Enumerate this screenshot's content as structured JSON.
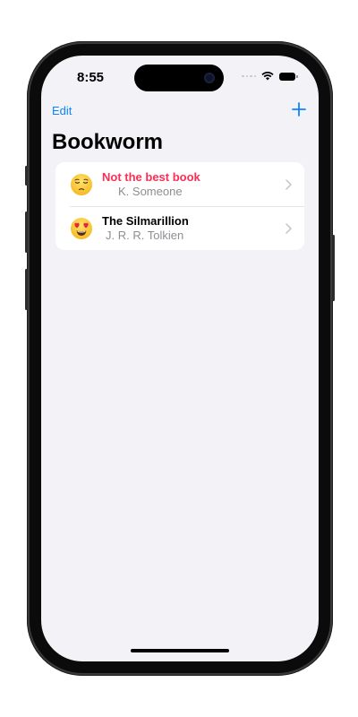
{
  "status_bar": {
    "time": "8:55"
  },
  "nav": {
    "edit_label": "Edit",
    "add_icon": "plus-icon",
    "title": "Bookworm"
  },
  "books": [
    {
      "title": "Not the best book",
      "author": "K. Someone",
      "rating_icon": "sad-face-emoji",
      "title_color": "#ff2d55"
    },
    {
      "title": "The Silmarillion",
      "author": "J. R. R. Tolkien",
      "rating_icon": "heart-eyes-emoji",
      "title_color": "#000000"
    }
  ],
  "colors": {
    "accent": "#0a84ff",
    "background": "#f2f2f7",
    "secondary_text": "#8e8e93"
  }
}
